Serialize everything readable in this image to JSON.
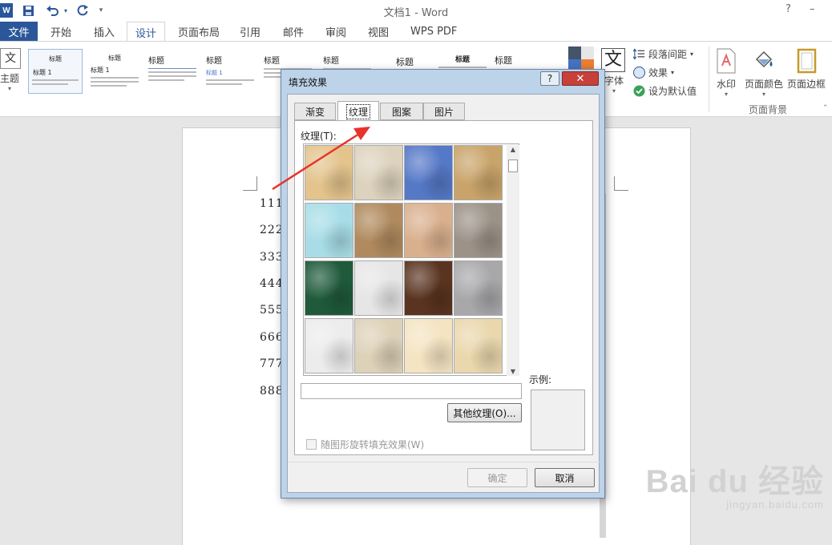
{
  "window": {
    "title": "文档1 - Word",
    "help_symbol": "?",
    "minimize_symbol": "–"
  },
  "quick_access": {
    "save_icon": "save-icon",
    "undo_icon": "undo-icon",
    "redo_icon": "redo-icon",
    "customize_symbol": "▾"
  },
  "tabs": {
    "file": "文件",
    "items": [
      "开始",
      "插入",
      "设计",
      "页面布局",
      "引用",
      "邮件",
      "审阅",
      "视图",
      "WPS PDF"
    ],
    "active": "设计"
  },
  "ribbon": {
    "theme_label": "主题",
    "theme_icon_text": "文",
    "style_items": [
      {
        "heading": "标题",
        "sub": "标题 1"
      },
      {
        "heading": "标题",
        "sub": "标题 1"
      },
      {
        "heading": "标题",
        "sub": ""
      },
      {
        "heading": "标题",
        "sub": "标题 1"
      },
      {
        "heading": "标题",
        "sub": ""
      },
      {
        "heading": "标题",
        "sub": ""
      },
      {
        "heading": "标题",
        "sub": ""
      },
      {
        "heading": "标题",
        "sub": ""
      },
      {
        "heading": "标题",
        "sub": ""
      }
    ],
    "font_label": "字体",
    "font_icon_text": "文",
    "paragraph_spacing": "段落间距",
    "effects": "效果",
    "set_default": "设为默认值",
    "watermark": "水印",
    "page_color": "页面颜色",
    "page_border": "页面边框",
    "page_background_group": "页面背景",
    "colors": {
      "accent": "#2b579a",
      "swatch_tl": "#44546a",
      "swatch_tr": "#e7e6e6",
      "swatch_bl": "#4472c4",
      "swatch_br": "#ed7d31"
    }
  },
  "document": {
    "lines": [
      "1111",
      "2222",
      "3333",
      "4444",
      "5555",
      "6666",
      "7777",
      "8888"
    ]
  },
  "dialog": {
    "title": "填充效果",
    "tabs": [
      "渐变",
      "纹理",
      "图案",
      "图片"
    ],
    "active_tab": "纹理",
    "texture_label": "纹理(T):",
    "texture_name_value": "",
    "more_textures": "其他纹理(O)...",
    "rotate_checkbox": "随图形旋转填充效果(W)",
    "rotate_checked": false,
    "sample_label": "示例:",
    "ok": "确定",
    "cancel": "取消",
    "textures": [
      {
        "name": "papyrus",
        "color": "#e3c48d"
      },
      {
        "name": "canvas",
        "color": "#ddd2bd"
      },
      {
        "name": "denim",
        "color": "#5578c7"
      },
      {
        "name": "woven-mat",
        "color": "#c9a46a"
      },
      {
        "name": "water-droplets",
        "color": "#a8dde7"
      },
      {
        "name": "paper-bag",
        "color": "#b08a5e"
      },
      {
        "name": "fish-fossil",
        "color": "#d9b08e"
      },
      {
        "name": "sand",
        "color": "#9c9288"
      },
      {
        "name": "green-marble",
        "color": "#1f5a3b"
      },
      {
        "name": "white-marble",
        "color": "#e6e6e6"
      },
      {
        "name": "brown-marble",
        "color": "#5a3420"
      },
      {
        "name": "granite",
        "color": "#a8a8ab"
      },
      {
        "name": "newsprint",
        "color": "#ececec"
      },
      {
        "name": "recycled-paper",
        "color": "#ddd1b8"
      },
      {
        "name": "parchment",
        "color": "#f4e4c2"
      },
      {
        "name": "stationery",
        "color": "#ead7ad"
      }
    ]
  },
  "watermark": {
    "main": "Bai du 经验",
    "sub": "jingyan.baidu.com"
  }
}
